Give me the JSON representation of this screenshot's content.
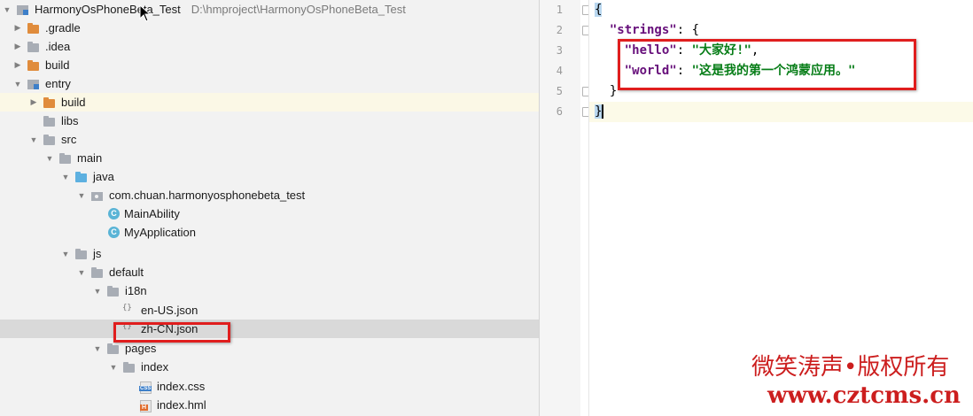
{
  "tree": {
    "root": {
      "label": "HarmonyOsPhoneBeta_Test",
      "path": "D:\\hmproject\\HarmonyOsPhoneBeta_Test"
    },
    "items": [
      {
        "label": ".gradle"
      },
      {
        "label": ".idea"
      },
      {
        "label": "build"
      },
      {
        "label": "entry"
      },
      {
        "label": "build"
      },
      {
        "label": "libs"
      },
      {
        "label": "src"
      },
      {
        "label": "main"
      },
      {
        "label": "java"
      },
      {
        "label": "com.chuan.harmonyosphonebeta_test"
      },
      {
        "label": "MainAbility"
      },
      {
        "label": "MyApplication"
      },
      {
        "label": "js"
      },
      {
        "label": "default"
      },
      {
        "label": "i18n"
      },
      {
        "label": "en-US.json"
      },
      {
        "label": "zh-CN.json"
      },
      {
        "label": "pages"
      },
      {
        "label": "index"
      },
      {
        "label": "index.css"
      },
      {
        "label": "index.hml"
      }
    ],
    "class_badge": "C"
  },
  "editor": {
    "line_numbers": [
      "1",
      "2",
      "3",
      "4",
      "5",
      "6"
    ],
    "code": {
      "l1": "{",
      "l2_key": "\"strings\"",
      "l2_rest": ": {",
      "l3_key": "\"hello\"",
      "l3_sep": ": ",
      "l3_val": "\"大家好!\"",
      "l3_end": ",",
      "l4_key": "\"world\"",
      "l4_sep": ": ",
      "l4_val": "\"这是我的第一个鸿蒙应用。\"",
      "l5": "}",
      "l6": "}"
    }
  },
  "watermark": {
    "line1": "微笑涛声•版权所有",
    "line2": "www.cztcms.cn"
  },
  "colors": {
    "highlight_box": "#e01e1e",
    "json_key": "#660e7a",
    "json_string": "#067d17",
    "selected_row": "#d9d9d9"
  }
}
